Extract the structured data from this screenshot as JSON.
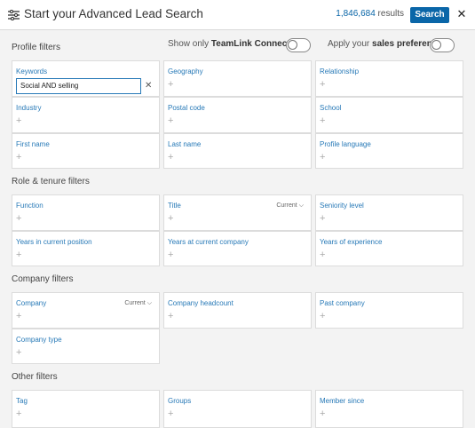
{
  "header": {
    "title": "Start your Advanced Lead Search",
    "result_count": "1,846,684",
    "results_label": "results",
    "search_label": "Search",
    "close_glyph": "✕"
  },
  "profile": {
    "title": "Profile filters",
    "teamlink_prefix": "Show only ",
    "teamlink_bold": "TeamLink Connections",
    "prefs_prefix": "Apply your ",
    "prefs_bold": "sales preferences",
    "keywords_label": "Keywords",
    "keywords_value": "Social AND selling",
    "clear_glyph": "✕",
    "geography": "Geography",
    "relationship": "Relationship",
    "industry": "Industry",
    "postal_code": "Postal code",
    "school": "School",
    "first_name": "First name",
    "last_name": "Last name",
    "profile_language": "Profile language"
  },
  "role": {
    "title": "Role & tenure filters",
    "function": "Function",
    "title_filter": "Title",
    "title_current": "Current",
    "seniority": "Seniority level",
    "years_position": "Years in current position",
    "years_company": "Years at current company",
    "years_experience": "Years of experience"
  },
  "company": {
    "title": "Company filters",
    "company": "Company",
    "company_current": "Current",
    "headcount": "Company headcount",
    "past_company": "Past company",
    "company_type": "Company type"
  },
  "other": {
    "title": "Other filters",
    "tag": "Tag",
    "groups": "Groups",
    "member_since": "Member since"
  },
  "plus_glyph": "+",
  "caret_glyph": "⌵",
  "colors": {
    "accent": "#0a66a8",
    "label": "#2779b7"
  }
}
